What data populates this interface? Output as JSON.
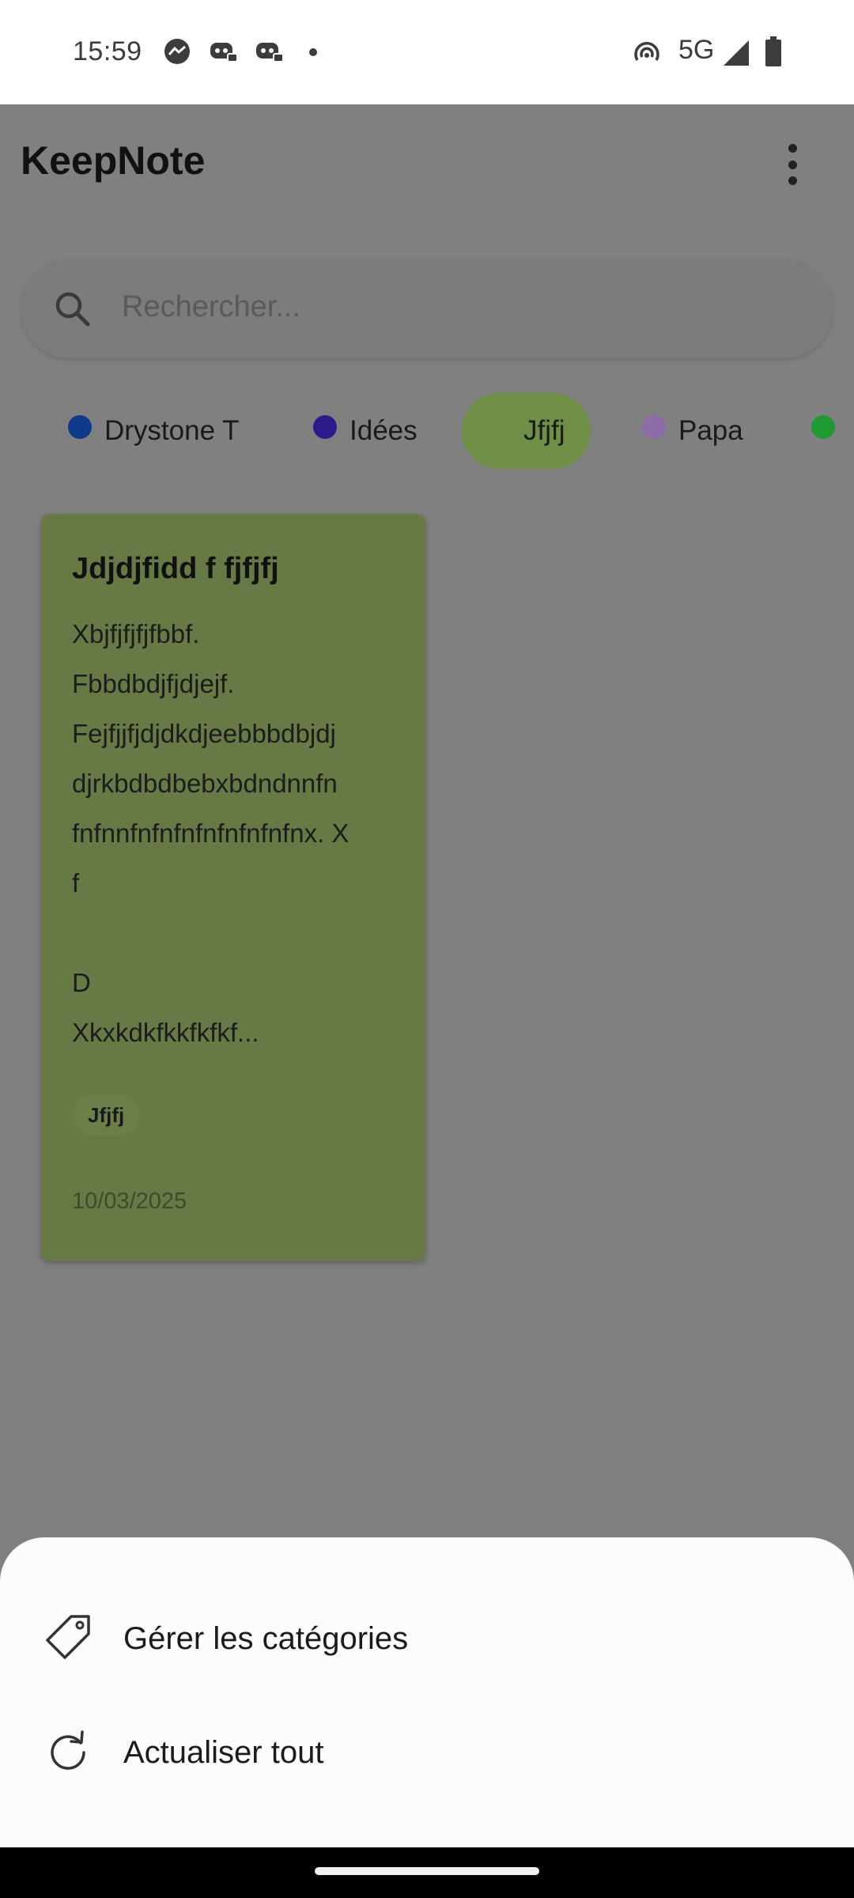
{
  "status_bar": {
    "time": "15:59",
    "network": "5G",
    "icons": [
      "messenger-icon",
      "discord-icon",
      "discord-icon",
      "notification-dot-icon",
      "hotspot-icon",
      "signal-icon",
      "battery-icon"
    ]
  },
  "app": {
    "title": "KeepNote",
    "menu_icon": "more-vert-icon"
  },
  "search": {
    "placeholder": "Rechercher...",
    "icon": "search-icon"
  },
  "categories": [
    {
      "label": "Drystone T",
      "color": "#0d3a8a",
      "active": false
    },
    {
      "label": "Idées",
      "color": "#2d1a8a",
      "active": false
    },
    {
      "label": "Jfjfj",
      "color": "#6f8f46",
      "active": true
    },
    {
      "label": "Papa",
      "color": "#8d6aa8",
      "active": false
    },
    {
      "label": "",
      "color": "#1f9a32",
      "active": false
    }
  ],
  "note": {
    "title": "Jdjdjfidd f fjfjfj",
    "body": "Xbjfjfjfjfbbf.\nFbbdbdjfjdjejf.\nFejfjjfjdjdkdjeebbbdbjdj\ndjrkbdbdbebxbdndnnfn\nfnfnnfnfnfnfnfnfnfnfnx. X\nf\n\nD\nXkxkdkfkkfkfkf...",
    "tag": "Jfjfj",
    "date": "10/03/2025",
    "color": "#677a45"
  },
  "sheet": {
    "items": [
      {
        "label": "Gérer les catégories",
        "icon": "tag-icon"
      },
      {
        "label": "Actualiser tout",
        "icon": "refresh-icon"
      }
    ]
  }
}
